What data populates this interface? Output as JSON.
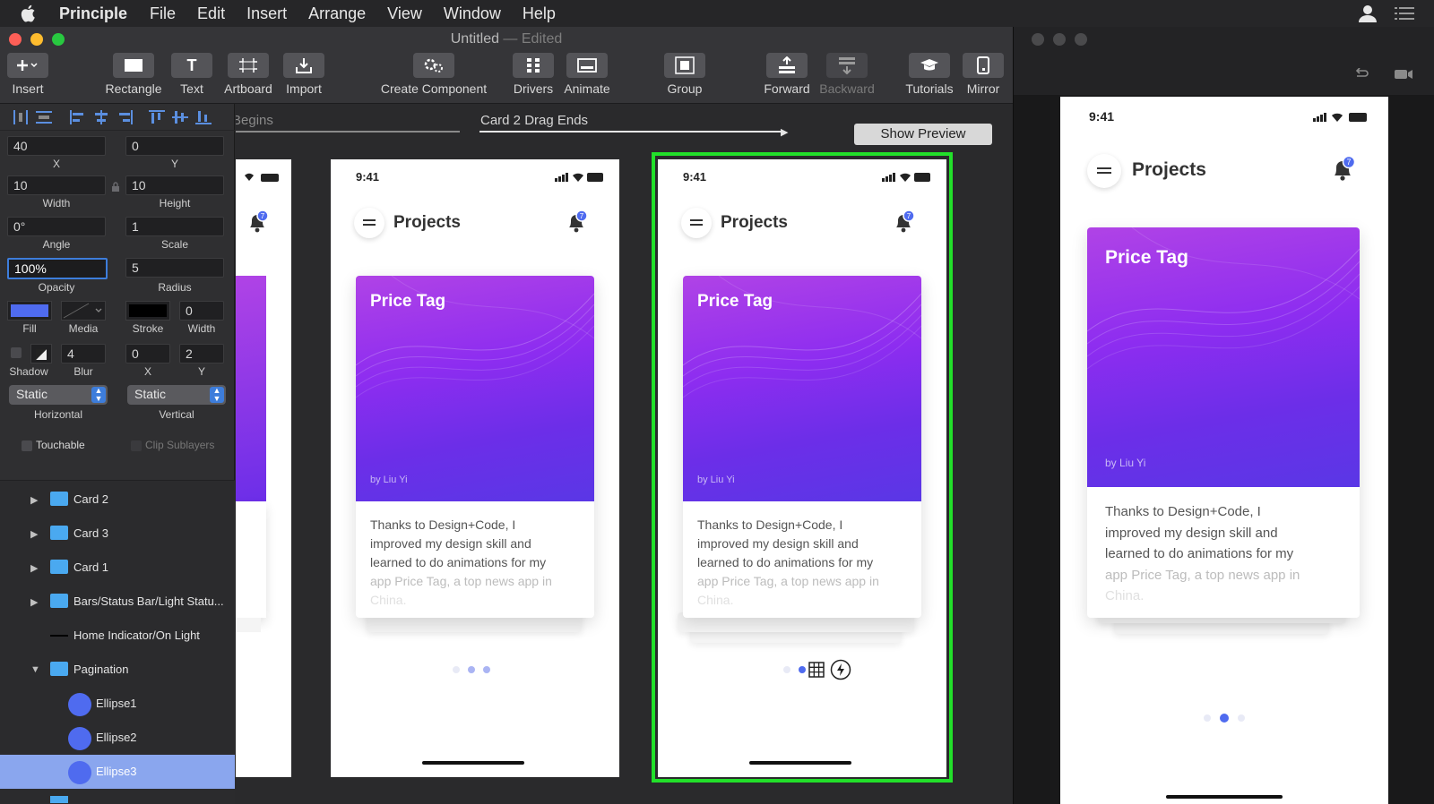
{
  "menubar": {
    "app": "Principle",
    "items": [
      "File",
      "Edit",
      "Insert",
      "Arrange",
      "View",
      "Window",
      "Help"
    ]
  },
  "window": {
    "title": "Untitled",
    "status": "Edited",
    "sep": " — "
  },
  "toolbar": {
    "insert": "Insert",
    "rectangle": "Rectangle",
    "text": "Text",
    "artboard": "Artboard",
    "import": "Import",
    "create_component": "Create Component",
    "drivers": "Drivers",
    "animate": "Animate",
    "group": "Group",
    "forward": "Forward",
    "backward": "Backward",
    "tutorials": "Tutorials",
    "mirror": "Mirror"
  },
  "inspector": {
    "x": "40",
    "x_label": "X",
    "y": "0",
    "y_label": "Y",
    "width": "10",
    "width_label": "Width",
    "height": "10",
    "height_label": "Height",
    "angle": "0°",
    "angle_label": "Angle",
    "scale": "1",
    "scale_label": "Scale",
    "opacity": "100%",
    "opacity_label": "Opacity",
    "radius": "5",
    "radius_label": "Radius",
    "fill_label": "Fill",
    "media_label": "Media",
    "stroke_label": "Stroke",
    "stroke_width": "0",
    "stroke_width_label": "Width",
    "shadow_label": "Shadow",
    "blur": "4",
    "blur_label": "Blur",
    "shadow_x": "0",
    "shadow_x_label": "X",
    "shadow_y": "2",
    "shadow_y_label": "Y",
    "horizontal": "Static",
    "horizontal_label": "Horizontal",
    "vertical": "Static",
    "vertical_label": "Vertical",
    "touchable": "Touchable",
    "clip_sublayers": "Clip Sublayers",
    "fill_color": "#4f6bef"
  },
  "layers": [
    {
      "label": "Card 2",
      "type": "folder",
      "expanded": false
    },
    {
      "label": "Card 3",
      "type": "folder",
      "expanded": false
    },
    {
      "label": "Card 1",
      "type": "folder",
      "expanded": false
    },
    {
      "label": "Bars/Status Bar/Light Statu...",
      "type": "folder",
      "expanded": false
    },
    {
      "label": "Home Indicator/On Light",
      "type": "line"
    },
    {
      "label": "Pagination",
      "type": "folder",
      "expanded": true
    },
    {
      "label": "Ellipse1",
      "type": "ellipse"
    },
    {
      "label": "Ellipse2",
      "type": "ellipse"
    },
    {
      "label": "Ellipse3",
      "type": "ellipse",
      "selected": true
    }
  ],
  "timeline": {
    "begins": "Begins",
    "drag_ends": "Card 2 Drag Ends",
    "show_preview": "Show Preview"
  },
  "screen": {
    "time": "9:41",
    "title": "Projects",
    "badge": "7",
    "card_title": "Price Tag",
    "card_by": "by Liu Yi",
    "card_text_1": "Thanks to Design+Code, I",
    "card_text_2": "improved my design skill and",
    "card_text_3": "learned to do animations for my",
    "card_text_4": "app Price Tag, a top news app in",
    "card_text_5": "China."
  },
  "colors": {
    "selection": "#22e02a",
    "accent": "#3d7ddb",
    "card_gradient_top": "#b043e6",
    "card_gradient_bottom": "#5a37e6",
    "pagination_active": "#4f6bef"
  }
}
